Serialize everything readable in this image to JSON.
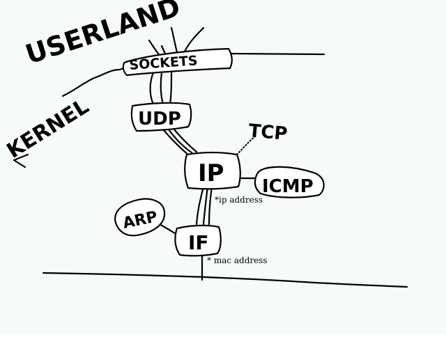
{
  "labels": {
    "userland": "USERLAND",
    "kernel": "KERNEL",
    "sockets": "SOCKETS",
    "udp": "UDP",
    "tcp": "TCP",
    "ip": "IP",
    "icmp": "ICMP",
    "arp": "ARP",
    "if": "IF"
  },
  "notes": {
    "ip_address": "*ip address",
    "mac_address": "* mac address"
  },
  "colors": {
    "ink": "#000000",
    "background": "#f7fbf8",
    "box_fill": "#ffffff"
  }
}
